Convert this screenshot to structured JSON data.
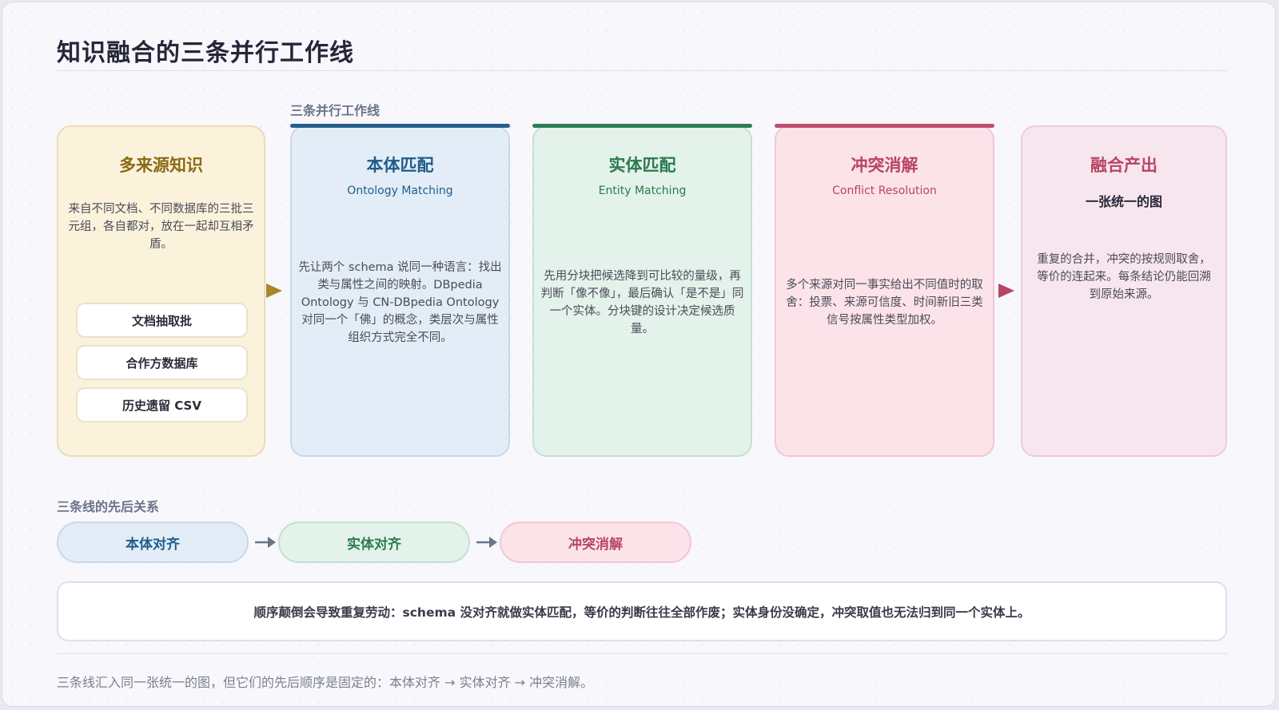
{
  "title": "知识融合的三条并行工作线",
  "parallel_label": "三条并行工作线",
  "source": {
    "title": "多来源知识",
    "desc": "来自不同文档、不同数据库的三批三元组，各自都对，放在一起却互相矛盾。",
    "items": [
      "文档抽取批",
      "合作方数据库",
      "历史遗留 CSV"
    ]
  },
  "lines": [
    {
      "title": "本体匹配",
      "subtitle": "Ontology Matching",
      "desc": "先让两个 schema 说同一种语言：找出类与属性之间的映射。DBpedia Ontology 与 CN-DBpedia Ontology 对同一个「佛」的概念，类层次与属性组织方式完全不同。"
    },
    {
      "title": "实体匹配",
      "subtitle": "Entity Matching",
      "desc": "先用分块把候选降到可比较的量级，再判断「像不像」，最后确认「是不是」同一个实体。分块键的设计决定候选质量。"
    },
    {
      "title": "冲突消解",
      "subtitle": "Conflict Resolution",
      "desc": "多个来源对同一事实给出不同值时的取舍：投票、来源可信度、时间新旧三类信号按属性类型加权。"
    }
  ],
  "output": {
    "title": "融合产出",
    "subtitle": "一张统一的图",
    "desc": "重复的合并，冲突的按规则取舍，等价的连起来。每条结论仍能回溯到原始来源。"
  },
  "order_label": "三条线的先后关系",
  "order": [
    "本体对齐",
    "实体对齐",
    "冲突消解"
  ],
  "note": "顺序颠倒会导致重复劳动：schema 没对齐就做实体匹配，等价的判断往往全部作废；实体身份没确定，冲突取值也无法归到同一个实体上。",
  "footer": "三条线汇入同一张统一的图，但它们的先后顺序是固定的：本体对齐 → 实体对齐 → 冲突消解。",
  "colors": {
    "source": "#8a6a14",
    "ontology": "#1f5c8a",
    "entity": "#2b7a4f",
    "conflict": "#b84565",
    "arrow": "#6b7488"
  }
}
